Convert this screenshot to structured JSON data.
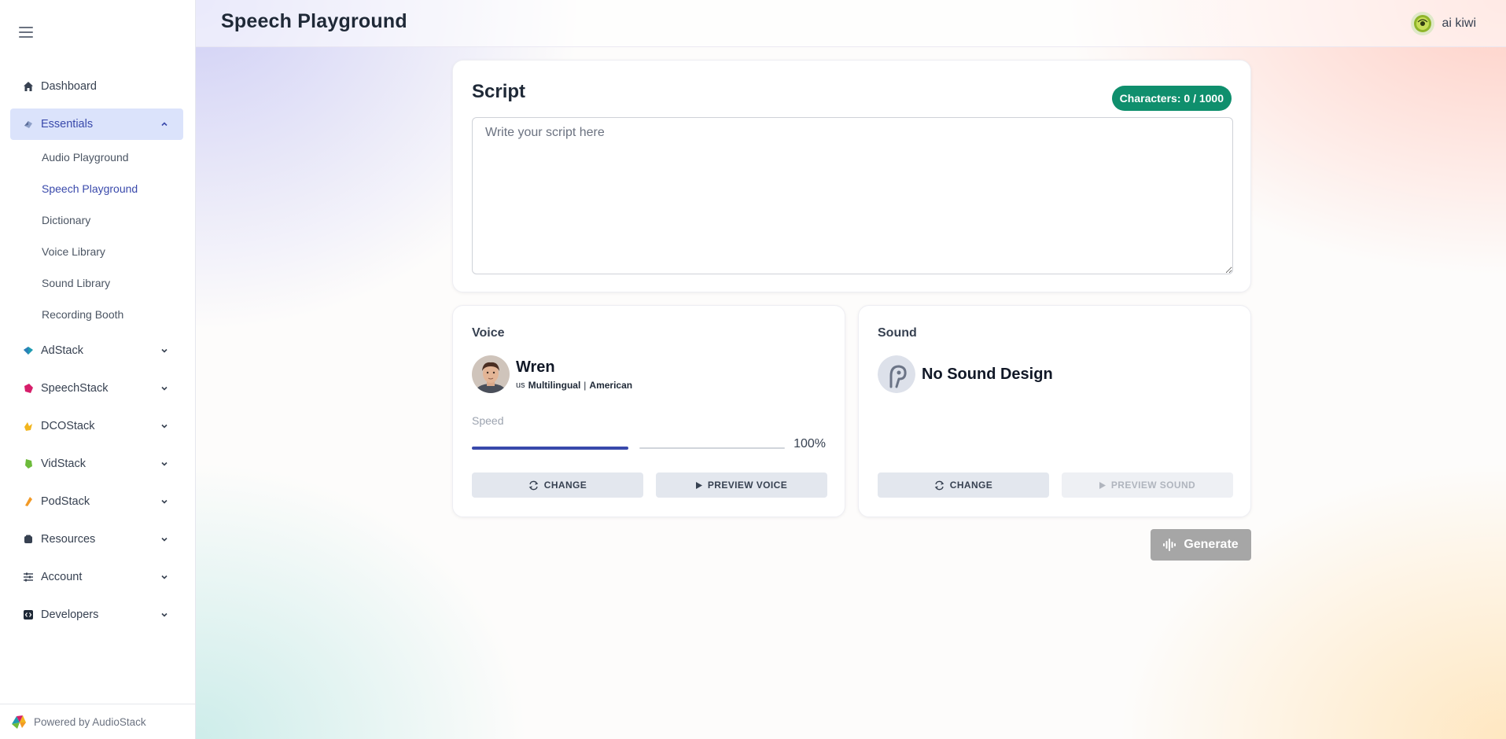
{
  "header": {
    "title": "Speech Playground",
    "user_name": "ai kiwi"
  },
  "sidebar": {
    "items": [
      {
        "label": "Dashboard",
        "icon": "home-icon",
        "color": "#374151"
      },
      {
        "label": "Essentials",
        "icon": "essentials-icon",
        "color": "#3949ab",
        "expanded": true,
        "active": true
      },
      {
        "label": "AdStack",
        "icon": "adstack-icon",
        "color": "#1e9bb0"
      },
      {
        "label": "SpeechStack",
        "icon": "speechstack-icon",
        "color": "#d61e6a"
      },
      {
        "label": "DCOStack",
        "icon": "dcostack-icon",
        "color": "#f2b51d"
      },
      {
        "label": "VidStack",
        "icon": "vidstack-icon",
        "color": "#6dbb3b"
      },
      {
        "label": "PodStack",
        "icon": "podstack-icon",
        "color": "#f29a26"
      },
      {
        "label": "Resources",
        "icon": "resources-icon",
        "color": "#374151"
      },
      {
        "label": "Account",
        "icon": "account-icon",
        "color": "#374151"
      },
      {
        "label": "Developers",
        "icon": "developers-icon",
        "color": "#374151"
      }
    ],
    "essentials_sub": [
      {
        "label": "Audio Playground"
      },
      {
        "label": "Speech Playground",
        "current": true
      },
      {
        "label": "Dictionary"
      },
      {
        "label": "Voice Library"
      },
      {
        "label": "Sound Library"
      },
      {
        "label": "Recording Booth"
      }
    ],
    "footer": "Powered by AudioStack"
  },
  "script": {
    "title": "Script",
    "char_label": "Characters:",
    "char_count": "0 / 1000",
    "placeholder": "Write your script here",
    "value": ""
  },
  "voice": {
    "section": "Voice",
    "name": "Wren",
    "flag": "us",
    "language": "Multilingual",
    "separator": "|",
    "accent": "American",
    "speed_label": "Speed",
    "speed_value": "100%",
    "speed_fraction": 0.5,
    "change_label": "CHANGE",
    "preview_label": "PREVIEW VOICE"
  },
  "sound": {
    "section": "Sound",
    "name": "No Sound Design",
    "change_label": "CHANGE",
    "preview_label": "PREVIEW SOUND",
    "preview_disabled": true
  },
  "actions": {
    "generate_label": "Generate",
    "generate_disabled": true
  },
  "colors": {
    "accent": "#3949ab",
    "badge": "#0f8f6d",
    "generate_disabled": "#a6a6a6"
  }
}
